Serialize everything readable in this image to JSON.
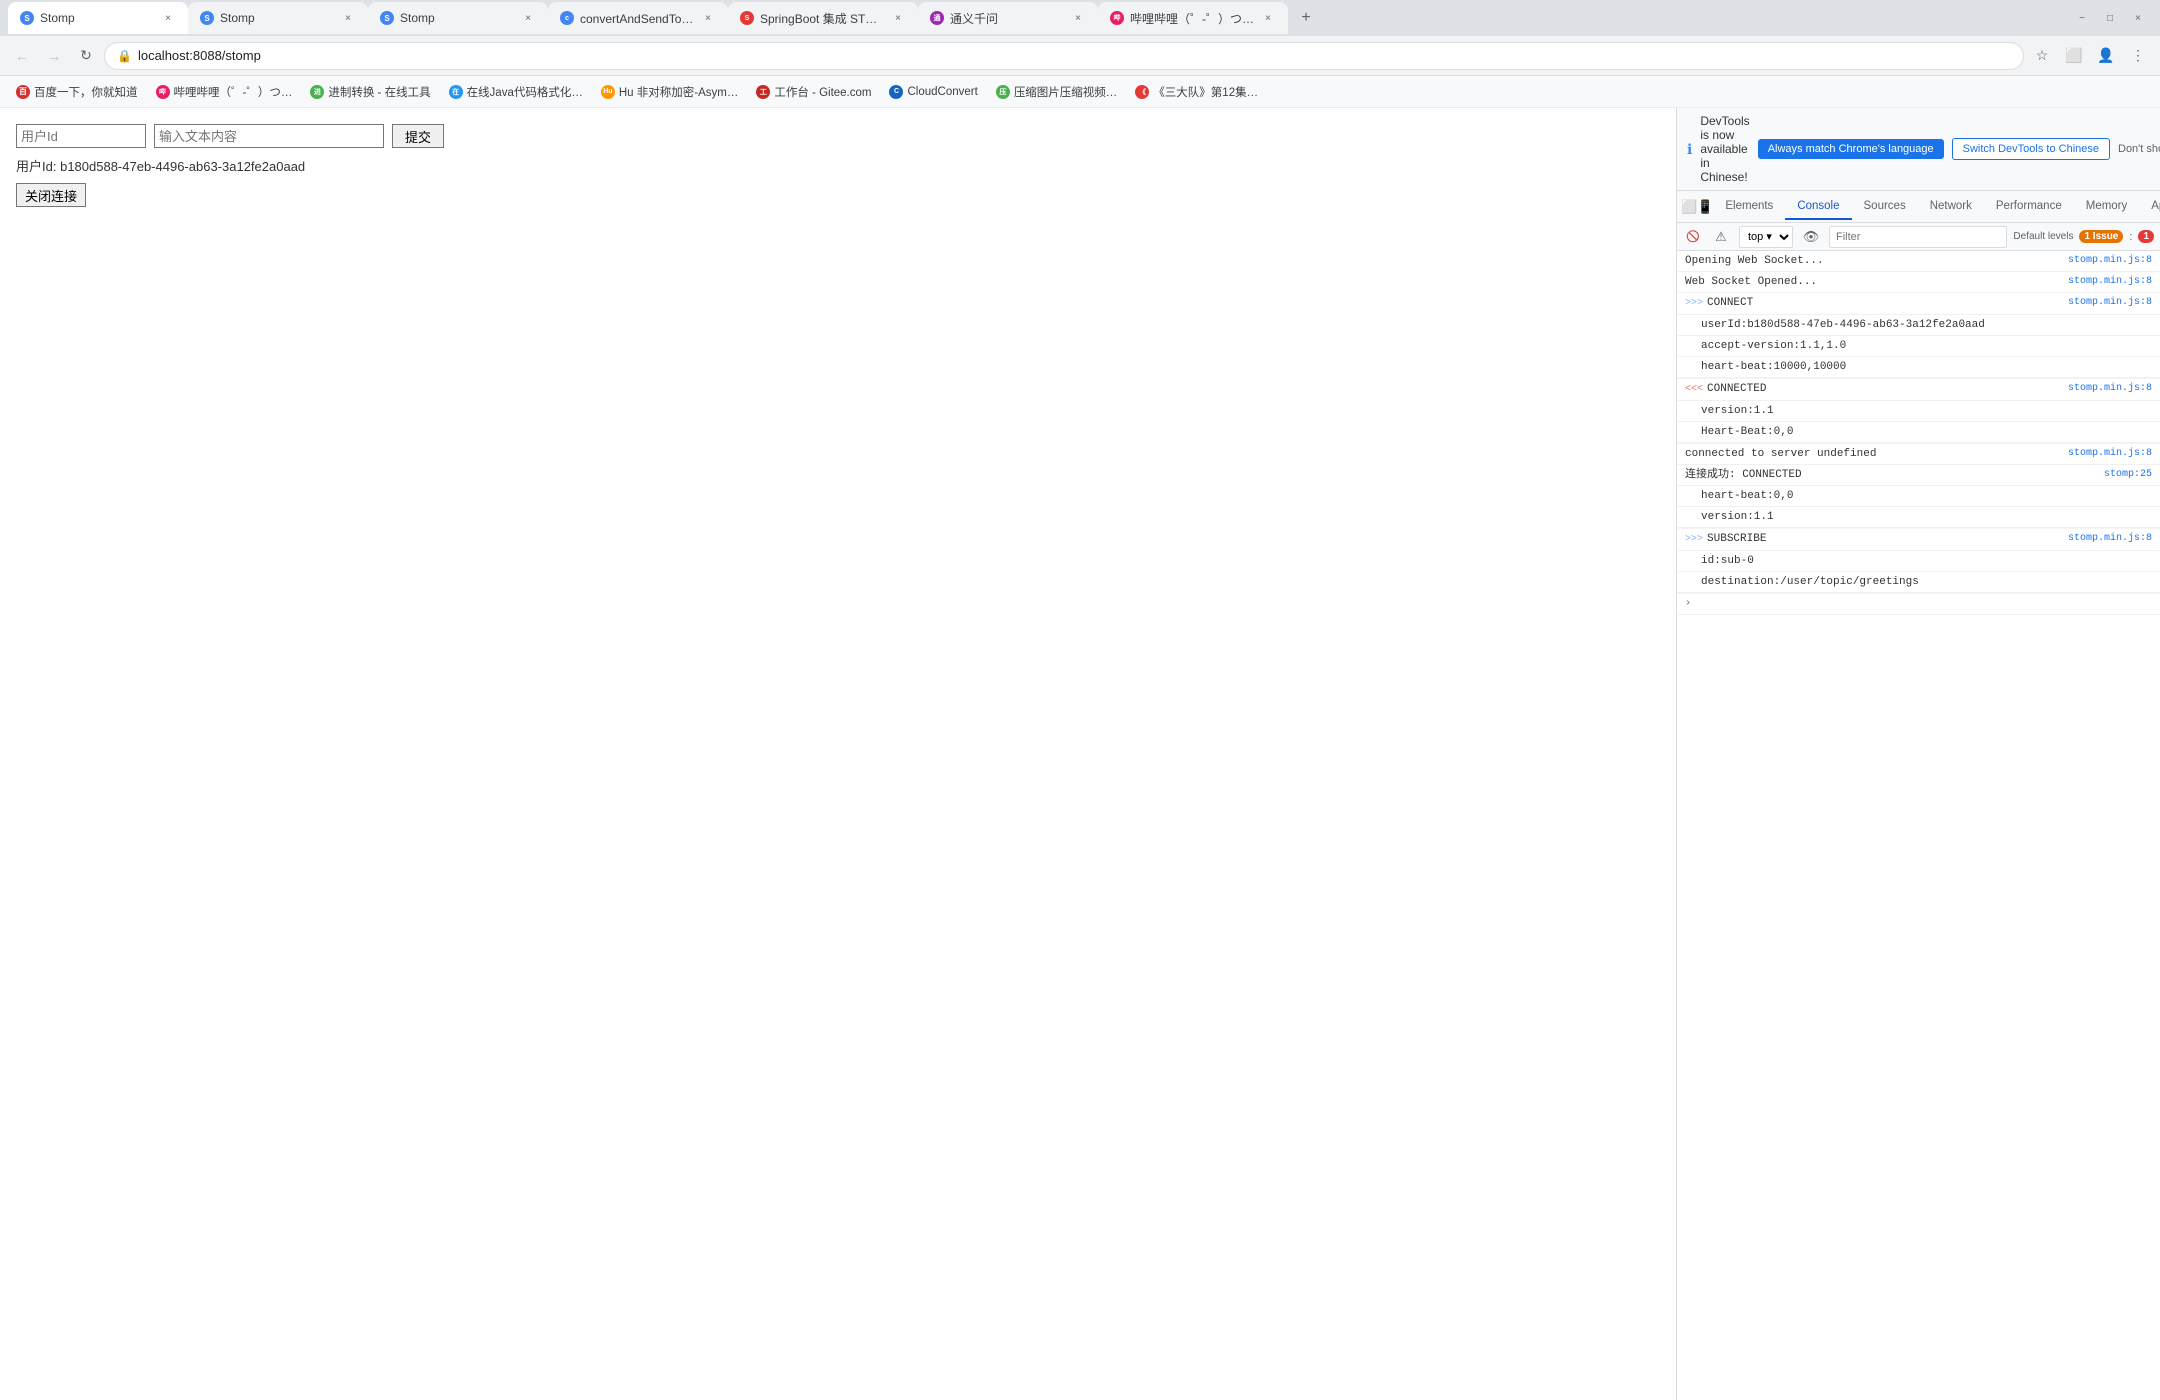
{
  "browser": {
    "tabs": [
      {
        "id": "tab1",
        "title": "Stomp",
        "url": "localhost:8088/stomp",
        "active": true,
        "favicon_color": "#4285f4",
        "favicon_letter": "S"
      },
      {
        "id": "tab2",
        "title": "Stomp",
        "url": "stomp",
        "active": false,
        "favicon_color": "#4285f4",
        "favicon_letter": "S"
      },
      {
        "id": "tab3",
        "title": "Stomp",
        "url": "stomp",
        "active": false,
        "favicon_color": "#4285f4",
        "favicon_letter": "S"
      },
      {
        "id": "tab4",
        "title": "convertAndSendToUser示例",
        "url": "",
        "active": false,
        "favicon_color": "#4285f4",
        "favicon_letter": "c"
      },
      {
        "id": "tab5",
        "title": "SpringBoot 集成 STOMP 实…",
        "url": "",
        "active": false,
        "favicon_color": "#e53935",
        "favicon_letter": "S"
      },
      {
        "id": "tab6",
        "title": "通义千问",
        "url": "",
        "active": false,
        "favicon_color": "#9c27b0",
        "favicon_letter": "通"
      },
      {
        "id": "tab7",
        "title": "哔哩哔哩（゜-゜）つロ 干杯~--b...",
        "url": "",
        "active": false,
        "favicon_color": "#e91e63",
        "favicon_letter": "哔"
      }
    ],
    "url": "localhost:8088/stomp",
    "window_controls": {
      "minimize": "−",
      "maximize": "□",
      "close": "×"
    }
  },
  "bookmarks": [
    {
      "label": "百度一下，你就知道",
      "favicon_color": "#d32f2f",
      "favicon_letter": "百"
    },
    {
      "label": "哔哩哔哩（゜-゜）つ…",
      "favicon_color": "#e91e63",
      "favicon_letter": "哔"
    },
    {
      "label": "进制转换 - 在线工具",
      "favicon_color": "#4caf50",
      "favicon_letter": "进"
    },
    {
      "label": "在线Java代码格式化…",
      "favicon_color": "#2196f3",
      "favicon_letter": "在"
    },
    {
      "label": "Hu 非对称加密-Asym…",
      "favicon_color": "#ff9800",
      "favicon_letter": "Hu"
    },
    {
      "label": "工作台 - Gitee.com",
      "favicon_color": "#c62828",
      "favicon_letter": "工"
    },
    {
      "label": "CloudConvert",
      "favicon_color": "#1565c0",
      "favicon_letter": "C"
    },
    {
      "label": "压缩图片压缩视频…",
      "favicon_color": "#4caf50",
      "favicon_letter": "压"
    },
    {
      "label": "《三大队》第12集…",
      "favicon_color": "#e53935",
      "favicon_letter": "《"
    }
  ],
  "page": {
    "form": {
      "userid_placeholder": "用户Id",
      "content_placeholder": "输入文本内容",
      "submit_label": "提交",
      "user_id_prefix": "用户Id:",
      "user_id_value": "b180d588-47eb-4496-ab63-3a12fe2a0aad",
      "close_conn_label": "关闭连接"
    }
  },
  "devtools": {
    "notification": {
      "text": "DevTools is now available in Chinese!",
      "btn_match_label": "Always match Chrome's language",
      "btn_switch_label": "Switch DevTools to Chinese",
      "dont_show_label": "Don't show again"
    },
    "tabs": [
      {
        "label": "Elements"
      },
      {
        "label": "Console",
        "active": true
      },
      {
        "label": "Sources"
      },
      {
        "label": "Network"
      },
      {
        "label": "Performance"
      },
      {
        "label": "Memory"
      },
      {
        "label": "Application"
      },
      {
        "label": "»"
      }
    ],
    "toolbar": {
      "level_label": "top",
      "filter_placeholder": "Filter",
      "default_levels_label": "Default levels",
      "issue_count": "1",
      "settings_badge": "1"
    },
    "console_lines": [
      {
        "type": "normal",
        "content": "Opening Web Socket...",
        "source": "stomp.min.js:8"
      },
      {
        "type": "normal",
        "content": "Web Socket Opened...",
        "source": "stomp.min.js:8"
      },
      {
        "type": "send",
        "prefix": ">>>",
        "header": "CONNECT",
        "body": "userId:b180d588-47eb-4496-ab63-3a12fe2a0aad\naccept-version:1.1,1.0\nheart-beat:10000,10000",
        "source": "stomp.min.js:8"
      },
      {
        "type": "receive",
        "prefix": "<<<",
        "header": "CONNECTED",
        "body": "version:1.1\nHeart-Beat:0,0",
        "source": "stomp.min.js:8"
      },
      {
        "type": "normal",
        "content": "connected to server undefined",
        "source": "stomp.min.js:8"
      },
      {
        "type": "normal",
        "content": "连接成功: CONNECTED\nheart-beat:0,0\nversion:1.1",
        "source": "stomp:25"
      },
      {
        "type": "send",
        "prefix": ">>>",
        "header": "SUBSCRIBE",
        "body": "id:sub-0\ndestination:/user/topic/greetings",
        "source": "stomp.min.js:8"
      }
    ],
    "expand_arrow": "›"
  }
}
